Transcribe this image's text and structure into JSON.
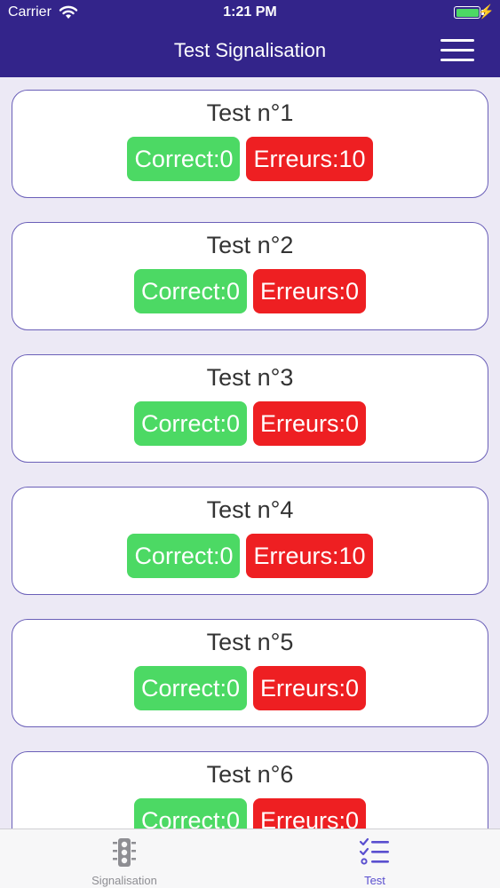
{
  "status_bar": {
    "carrier": "Carrier",
    "time": "1:21 PM",
    "battery_color": "#4cd964"
  },
  "nav": {
    "title": "Test Signalisation",
    "menu_icon": "hamburger-menu-icon",
    "background_color": "#33248a"
  },
  "tests": [
    {
      "title": "Test n°1",
      "correct": "Correct:0",
      "errors": "Erreurs:10"
    },
    {
      "title": "Test n°2",
      "correct": "Correct:0",
      "errors": "Erreurs:0"
    },
    {
      "title": "Test n°3",
      "correct": "Correct:0",
      "errors": "Erreurs:0"
    },
    {
      "title": "Test n°4",
      "correct": "Correct:0",
      "errors": "Erreurs:10"
    },
    {
      "title": "Test n°5",
      "correct": "Correct:0",
      "errors": "Erreurs:0"
    },
    {
      "title": "Test n°6",
      "correct": "Correct:0",
      "errors": "Erreurs:0"
    }
  ],
  "colors": {
    "correct": "#4cd964",
    "errors": "#ee1f22",
    "card_border": "#6a5fb8",
    "tab_active": "#5a4fcf",
    "tab_inactive": "#8e8e93"
  },
  "tab_bar": {
    "tabs": [
      {
        "label": "Signalisation",
        "icon": "traffic-light-icon",
        "active": false
      },
      {
        "label": "Test",
        "icon": "checklist-icon",
        "active": true
      }
    ]
  }
}
